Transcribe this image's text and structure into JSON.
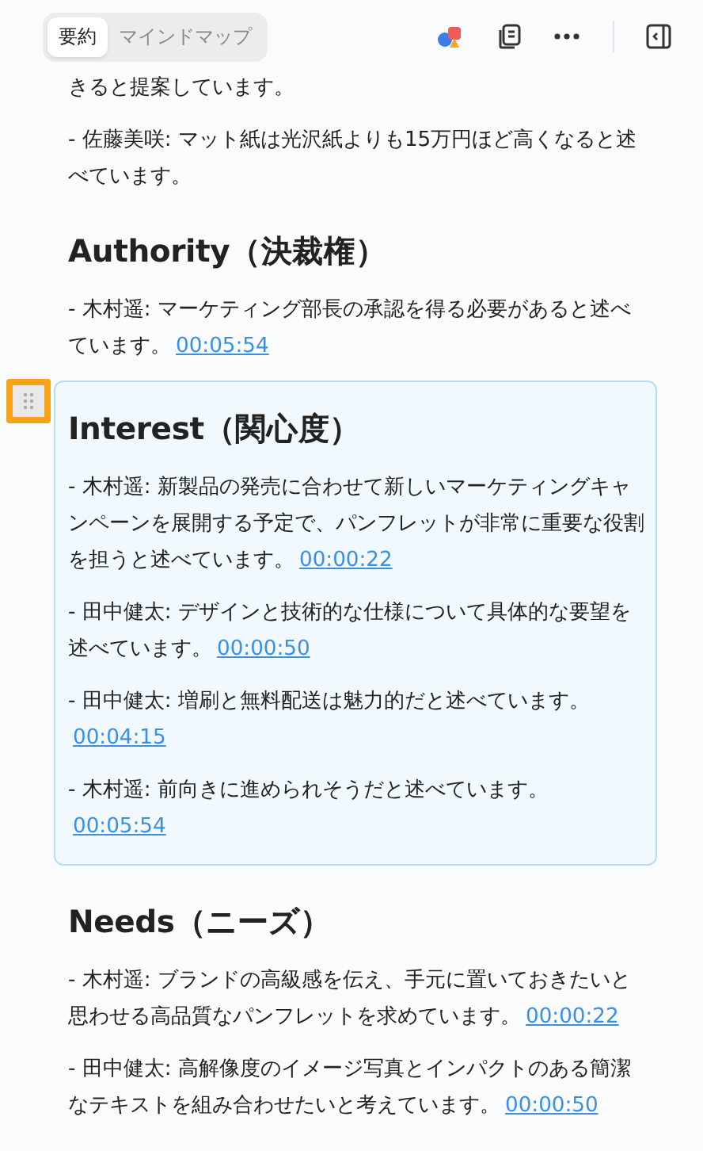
{
  "tabs": [
    {
      "label": "要約",
      "selected": true
    },
    {
      "label": "マインドマップ",
      "selected": false
    }
  ],
  "sections": [
    {
      "items": [
        {
          "text": "きると提案しています。"
        },
        {
          "text": "- 佐藤美咲: マット紙は光沢紙よりも15万円ほど高くなると述べています。"
        }
      ]
    },
    {
      "heading": "Authority（決裁権）",
      "highlighted": false,
      "items": [
        {
          "text": "- 木村遥: マーケティング部長の承認を得る必要があると述べています。",
          "timestamp": "00:05:54"
        }
      ]
    },
    {
      "heading": "Interest（関心度）",
      "highlighted": true,
      "items": [
        {
          "text": "- 木村遥: 新製品の発売に合わせて新しいマーケティングキャンペーンを展開する予定で、パンフレットが非常に重要な役割を担うと述べています。",
          "timestamp": "00:00:22"
        },
        {
          "text": "- 田中健太: デザインと技術的な仕様について具体的な要望を述べています。",
          "timestamp": "00:00:50"
        },
        {
          "text": "- 田中健太: 増刷と無料配送は魅力的だと述べています。",
          "timestamp": "00:04:15"
        },
        {
          "text": "- 木村遥: 前向きに進められそうだと述べています。",
          "timestamp": "00:05:54"
        }
      ]
    },
    {
      "heading": "Needs（ニーズ）",
      "highlighted": false,
      "items": [
        {
          "text": "- 木村遥: ブランドの高級感を伝え、手元に置いておきたいと思わせる高品質なパンフレットを求めています。",
          "timestamp": "00:00:22"
        },
        {
          "text": "- 田中健太: 高解像度のイメージ写真とインパクトのある簡潔なテキストを組み合わせたいと考えています。",
          "timestamp": "00:00:50"
        }
      ]
    }
  ]
}
